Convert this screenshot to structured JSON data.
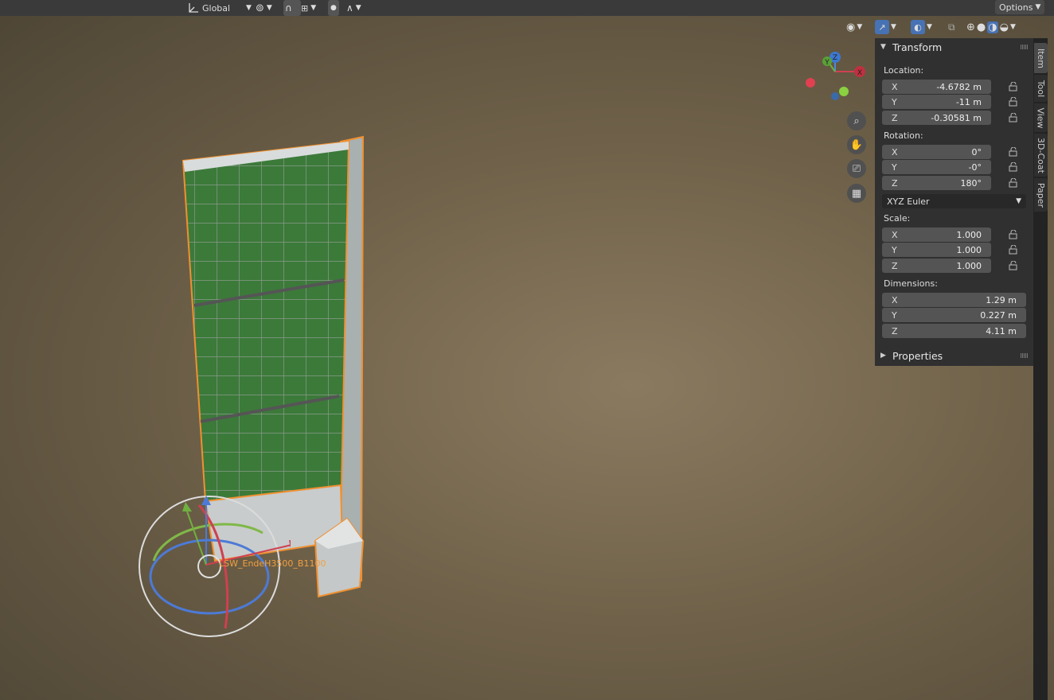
{
  "header": {
    "orientation": "Global",
    "options": "Options"
  },
  "viewport": {
    "object_name": "LSW_EndeH3500_B1100",
    "tools": [
      "zoom-icon",
      "hand-icon",
      "camera-icon",
      "grid-icon"
    ],
    "gizmo_axes": {
      "x": "X",
      "y": "Y",
      "z": "Z"
    }
  },
  "panel": {
    "transform_title": "Transform",
    "location_label": "Location:",
    "location": [
      {
        "axis": "X",
        "value": "-4.6782 m"
      },
      {
        "axis": "Y",
        "value": "-11 m"
      },
      {
        "axis": "Z",
        "value": "-0.30581 m"
      }
    ],
    "rotation_label": "Rotation:",
    "rotation": [
      {
        "axis": "X",
        "value": "0°"
      },
      {
        "axis": "Y",
        "value": "-0°"
      },
      {
        "axis": "Z",
        "value": "180°"
      }
    ],
    "rotation_mode": "XYZ Euler",
    "scale_label": "Scale:",
    "scale": [
      {
        "axis": "X",
        "value": "1.000"
      },
      {
        "axis": "Y",
        "value": "1.000"
      },
      {
        "axis": "Z",
        "value": "1.000"
      }
    ],
    "dimensions_label": "Dimensions:",
    "dimensions": [
      {
        "axis": "X",
        "value": "1.29 m"
      },
      {
        "axis": "Y",
        "value": "0.227 m"
      },
      {
        "axis": "Z",
        "value": "4.11 m"
      }
    ],
    "properties_title": "Properties"
  },
  "sidebar_tabs": [
    "Item",
    "Tool",
    "View",
    "3D-Coat",
    "Paper"
  ]
}
